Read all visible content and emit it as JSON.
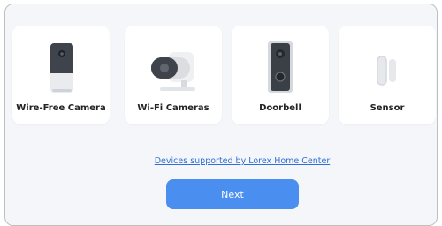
{
  "devices": [
    {
      "label": "Wire-Free Camera",
      "icon": "wire-free-camera-icon"
    },
    {
      "label": "Wi-Fi Cameras",
      "icon": "wifi-camera-icon"
    },
    {
      "label": "Doorbell",
      "icon": "doorbell-icon"
    },
    {
      "label": "Sensor",
      "icon": "sensor-icon"
    }
  ],
  "supported_link": "Devices supported by Lorex Home Center",
  "next_button": "Next",
  "colors": {
    "accent": "#4a8ff0",
    "link": "#2f6fd8",
    "background": "#f4f6f9"
  }
}
